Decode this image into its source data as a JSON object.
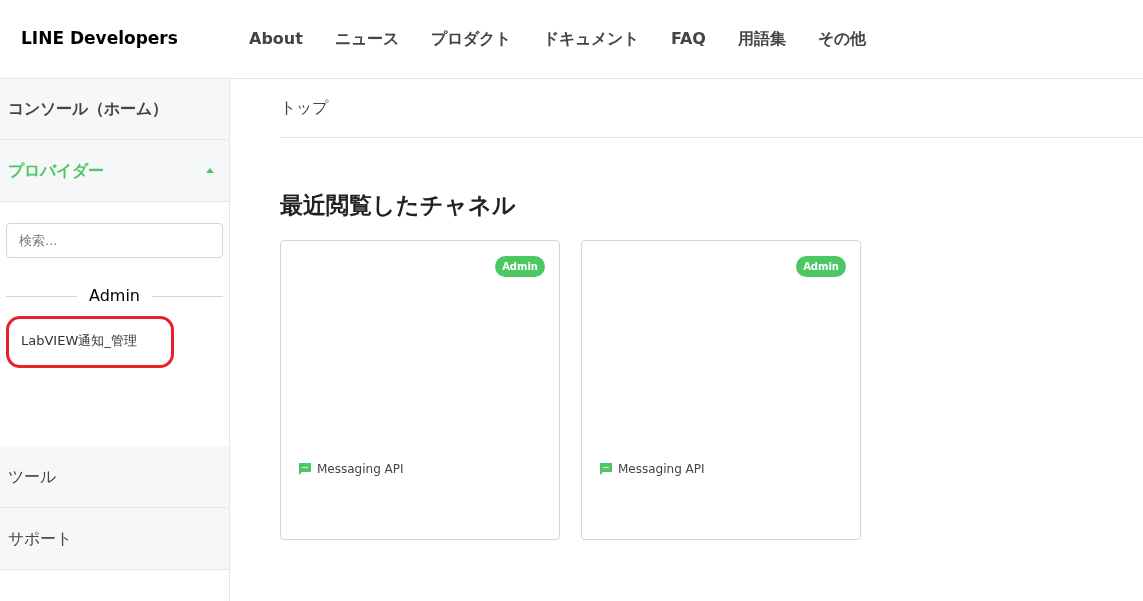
{
  "header": {
    "logo": "LINE Developers",
    "nav": [
      "About",
      "ニュース",
      "プロダクト",
      "ドキュメント",
      "FAQ",
      "用語集",
      "その他"
    ]
  },
  "sidebar": {
    "console": "コンソール（ホーム）",
    "providers": {
      "label": "プロバイダー",
      "expanded": true,
      "search_placeholder": "検索...",
      "group": "Admin",
      "items": [
        {
          "name": "LabVIEW通知_管理",
          "highlighted": true
        }
      ]
    },
    "links": [
      "ツール",
      "サポート"
    ]
  },
  "breadcrumb": "トップ",
  "section_title": "最近閲覧したチャネル",
  "channels": [
    {
      "badge": "Admin",
      "type": "Messaging API"
    },
    {
      "badge": "Admin",
      "type": "Messaging API"
    }
  ]
}
